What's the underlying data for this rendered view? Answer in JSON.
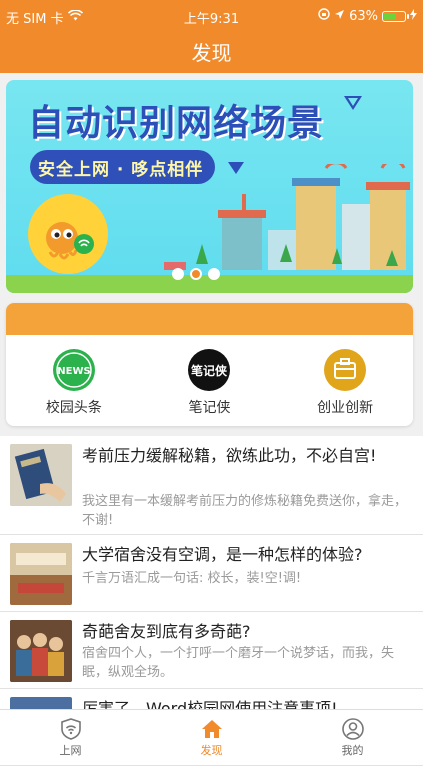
{
  "status_bar": {
    "carrier": "无 SIM 卡",
    "time": "上午9:31",
    "battery_percent": "63%",
    "battery_level": 0.63
  },
  "navbar": {
    "title": "发现"
  },
  "banner": {
    "headline": "自动识别网络场景",
    "slogan": "安全上网 · 哆点相伴",
    "active_slide_index": 1,
    "slide_count": 3
  },
  "shortcuts": [
    {
      "label": "校园头条",
      "icon": "news-icon",
      "color": "#2bb24c",
      "icon_text": "NEWS"
    },
    {
      "label": "笔记侠",
      "icon": "notes-icon",
      "color": "#111111",
      "icon_text": "笔记侠"
    },
    {
      "label": "创业创新",
      "icon": "briefcase-icon",
      "color": "#e0a51a",
      "icon_text": ""
    }
  ],
  "articles": [
    {
      "title": "考前压力缓解秘籍，欲练此功，不必自宫!",
      "desc": "我这里有一本缓解考前压力的修炼秘籍免费送你，拿走，不谢!"
    },
    {
      "title": "大学宿舍没有空调，是一种怎样的体验?",
      "desc": "千言万语汇成一句话: 校长，装!空!调!"
    },
    {
      "title": "奇葩舍友到底有多奇葩?",
      "desc": "宿舍四个人，一个打呼一个磨牙一个说梦话，而我，失眠，纵观全场。"
    },
    {
      "title": "厉害了，Word校园网使用注意事项!",
      "desc": ""
    }
  ],
  "tabbar": {
    "tabs": [
      {
        "label": "上网",
        "icon": "wifi-shield-icon"
      },
      {
        "label": "发现",
        "icon": "home-icon"
      },
      {
        "label": "我的",
        "icon": "profile-icon"
      }
    ],
    "active_tab": "发现"
  },
  "colors": {
    "accent": "#f08a2a",
    "banner_bg": "#5fdcef",
    "banner_text": "#2d4fb8"
  }
}
